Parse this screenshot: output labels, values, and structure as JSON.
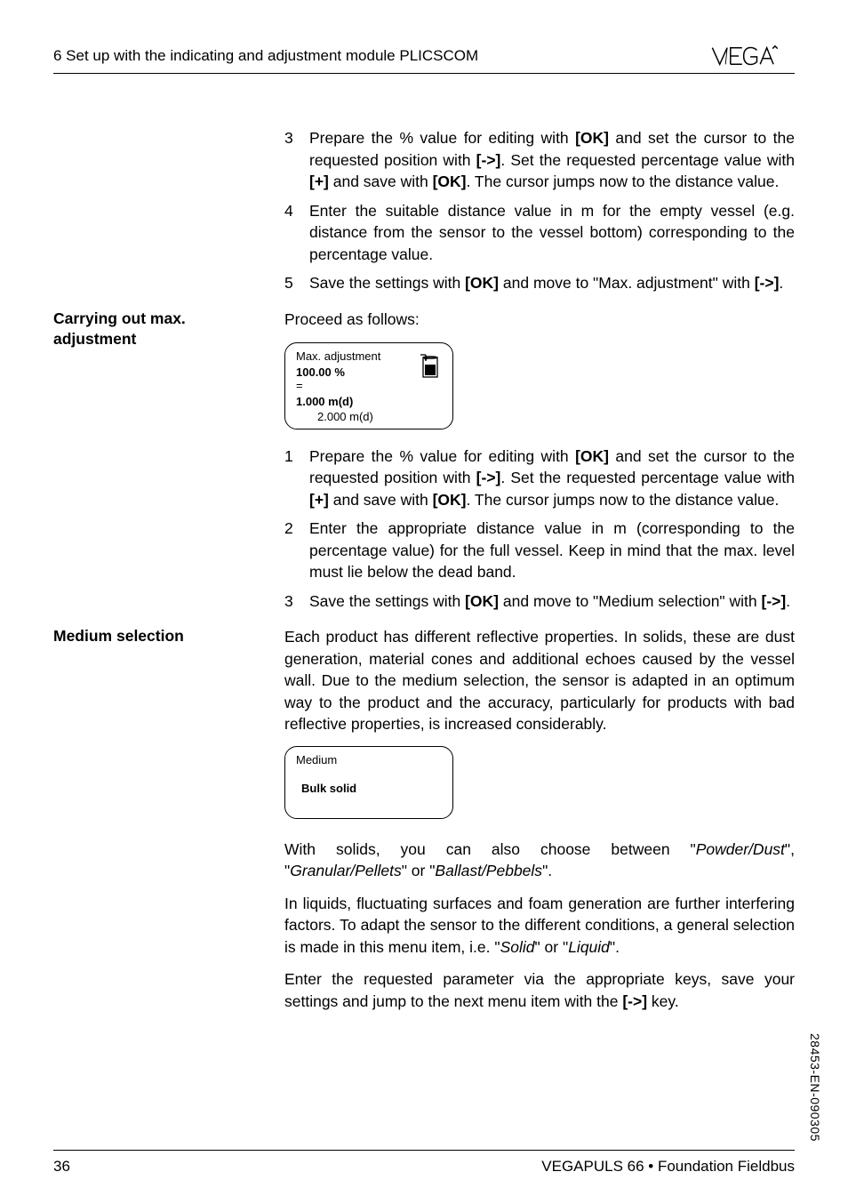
{
  "header": {
    "section": "6  Set up with the indicating and adjustment module PLICSCOM"
  },
  "list1": [
    {
      "num": "3",
      "text": "Prepare the % value for editing with [OK] and set the cursor to the requested position with [->]. Set the requested percentage value with [+] and save with [OK]. The cursor jumps now to the distance value."
    },
    {
      "num": "4",
      "text": "Enter the suitable distance value in m for the empty vessel (e.g. distance from the sensor to the vessel bottom) corresponding to the percentage value."
    },
    {
      "num": "5",
      "text": "Save the settings with [OK] and move to \"Max. adjustment\" with [->]."
    }
  ],
  "section_max": {
    "heading": "Carrying out max. adjustment",
    "intro": "Proceed as follows:",
    "lcd": {
      "title": "Max. adjustment",
      "percent": "100.00 %",
      "eq": "=",
      "dist": "1.000 m(d)",
      "dist2": "2.000 m(d)"
    },
    "list": [
      {
        "num": "1",
        "text": "Prepare the % value for editing with [OK] and set the cursor to the requested position with [->]. Set the requested percentage value with [+] and save with [OK]. The cursor jumps now to the distance value."
      },
      {
        "num": "2",
        "text": "Enter the appropriate distance value in m (corresponding to the percentage value) for the full vessel. Keep in mind that the max. level must lie below the dead band."
      },
      {
        "num": "3",
        "text": "Save the settings with [OK] and move to \"Medium selection\" with [->]."
      }
    ]
  },
  "section_medium": {
    "heading": "Medium selection",
    "p1": "Each product has different reflective properties. In solids, these are dust generation, material cones and additional echoes caused by the vessel wall. Due to the medium selection, the sensor is adapted in an optimum way to the product and the accuracy, particularly for products with bad reflective properties, is increased considerably.",
    "lcd": {
      "title": "Medium",
      "value": "Bulk solid"
    },
    "p2_pre": "With solids, you can also choose between \"",
    "p2_i1": "Powder/Dust",
    "p2_mid1": "\", \"",
    "p2_i2": "Granular/Pellets",
    "p2_mid2": "\" or \"",
    "p2_i3": "Ballast/Pebbels",
    "p2_post": "\".",
    "p3_pre": "In liquids, fluctuating surfaces and foam generation are further interfering factors. To adapt the sensor to the different conditions, a general selection is made in this menu item, i.e. \"",
    "p3_i1": "Solid",
    "p3_mid": "\" or \"",
    "p3_i2": "Liquid",
    "p3_post": "\".",
    "p4_pre": "Enter the requested parameter via the appropriate keys, save your settings and jump to the next menu item with the ",
    "p4_b": "[->]",
    "p4_post": " key."
  },
  "footer": {
    "page": "36",
    "product": "VEGAPULS 66 • Foundation Fieldbus"
  },
  "docid": "28453-EN-090305"
}
